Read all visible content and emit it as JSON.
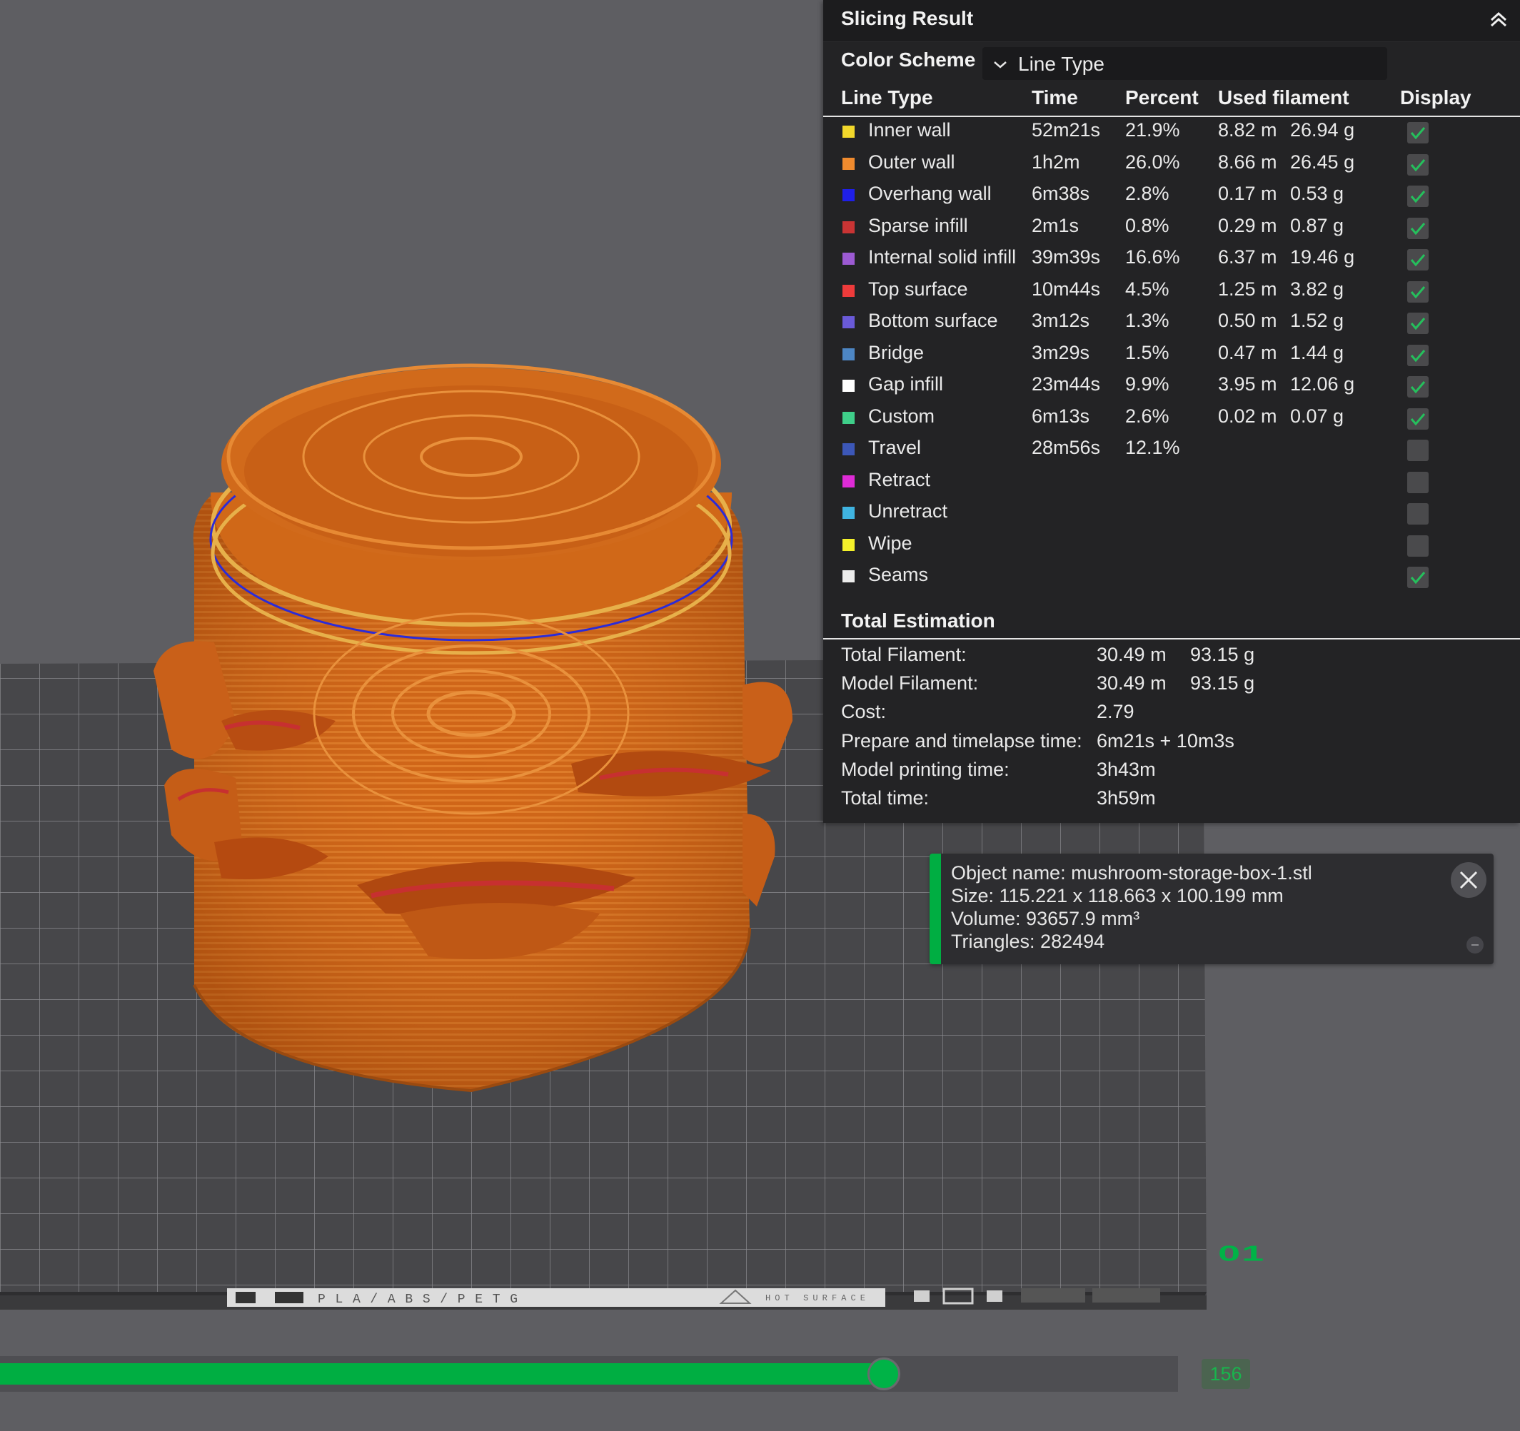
{
  "panel": {
    "title": "Slicing Result",
    "color_scheme_label": "Color Scheme",
    "color_scheme_value": "Line Type",
    "columns": [
      "Line Type",
      "Time",
      "Percent",
      "Used filament",
      "Display"
    ],
    "rows": [
      {
        "name": "Inner wall",
        "time": "52m21s",
        "percent": "21.9%",
        "length": "8.82 m",
        "weight": "26.94 g",
        "color": "#f2d82b",
        "checked": true
      },
      {
        "name": "Outer wall",
        "time": "1h2m",
        "percent": "26.0%",
        "length": "8.66 m",
        "weight": "26.45 g",
        "color": "#f08b2e",
        "checked": true
      },
      {
        "name": "Overhang wall",
        "time": "6m38s",
        "percent": "2.8%",
        "length": "0.17 m",
        "weight": "0.53 g",
        "color": "#1f1fe8",
        "checked": true
      },
      {
        "name": "Sparse infill",
        "time": "2m1s",
        "percent": "0.8%",
        "length": "0.29 m",
        "weight": "0.87 g",
        "color": "#c93434",
        "checked": true
      },
      {
        "name": "Internal solid infill",
        "time": "39m39s",
        "percent": "16.6%",
        "length": "6.37 m",
        "weight": "19.46 g",
        "color": "#9c5ad3",
        "checked": true
      },
      {
        "name": "Top surface",
        "time": "10m44s",
        "percent": "4.5%",
        "length": "1.25 m",
        "weight": "3.82 g",
        "color": "#ee3b3b",
        "checked": true
      },
      {
        "name": "Bottom surface",
        "time": "3m12s",
        "percent": "1.3%",
        "length": "0.50 m",
        "weight": "1.52 g",
        "color": "#6a5ad8",
        "checked": true
      },
      {
        "name": "Bridge",
        "time": "3m29s",
        "percent": "1.5%",
        "length": "0.47 m",
        "weight": "1.44 g",
        "color": "#4d86c4",
        "checked": true
      },
      {
        "name": "Gap infill",
        "time": "23m44s",
        "percent": "9.9%",
        "length": "3.95 m",
        "weight": "12.06 g",
        "color": "#ffffff",
        "checked": true
      },
      {
        "name": "Custom",
        "time": "6m13s",
        "percent": "2.6%",
        "length": "0.02 m",
        "weight": "0.07 g",
        "color": "#3fcf8a",
        "checked": true
      },
      {
        "name": "Travel",
        "time": "28m56s",
        "percent": "12.1%",
        "length": "",
        "weight": "",
        "color": "#3c57b8",
        "checked": false
      },
      {
        "name": "Retract",
        "time": "",
        "percent": "",
        "length": "",
        "weight": "",
        "color": "#de2bd6",
        "checked": false
      },
      {
        "name": "Unretract",
        "time": "",
        "percent": "",
        "length": "",
        "weight": "",
        "color": "#3fb3e0",
        "checked": false
      },
      {
        "name": "Wipe",
        "time": "",
        "percent": "",
        "length": "",
        "weight": "",
        "color": "#f4f12a",
        "checked": false
      },
      {
        "name": "Seams",
        "time": "",
        "percent": "",
        "length": "",
        "weight": "",
        "color": "#ececec",
        "checked": true
      }
    ],
    "total_title": "Total Estimation",
    "totals": [
      {
        "label": "Total Filament:",
        "v1": "30.49 m",
        "v2": "93.15 g"
      },
      {
        "label": "Model Filament:",
        "v1": "30.49 m",
        "v2": "93.15 g"
      },
      {
        "label": "Cost:",
        "v1": "2.79",
        "v2": ""
      },
      {
        "label": "Prepare and timelapse time:",
        "v1": "6m21s + 10m3s",
        "v2": ""
      },
      {
        "label": "Model printing time:",
        "v1": "3h43m",
        "v2": ""
      },
      {
        "label": "Total time:",
        "v1": "3h59m",
        "v2": ""
      }
    ]
  },
  "object_info": {
    "name": "Object name: mushroom-storage-box-1.stl",
    "size": "Size: 115.221 x 118.663 x 100.199 mm",
    "volume": "Volume: 93657.9 mm³",
    "triangles": "Triangles: 282494"
  },
  "plate": {
    "number": "01",
    "label": "PLA/ABS/PETG",
    "surface_label": "HOT SURFACE"
  },
  "slider": {
    "layer": "156",
    "fraction": 0.75
  },
  "colors": {
    "accent": "#00ae42",
    "model": "#d2691e",
    "panel": "#232325",
    "check": "#25c05c"
  }
}
